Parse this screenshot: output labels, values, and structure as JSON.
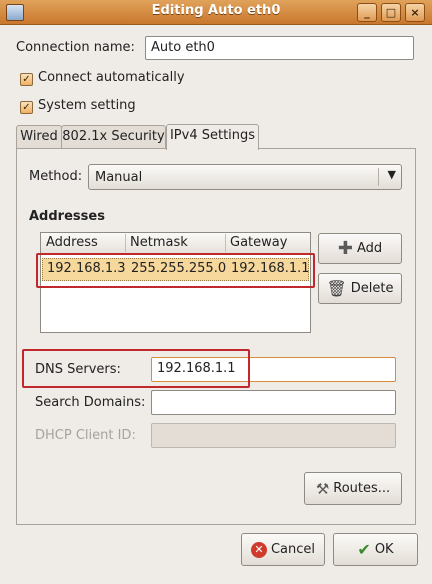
{
  "window": {
    "title": "Editing Auto eth0",
    "controls": [
      "_",
      "□",
      "×"
    ]
  },
  "connection": {
    "name_label": "Connection name:",
    "name_value": "Auto eth0"
  },
  "checkboxes": {
    "connect_auto": "Connect automatically",
    "system_setting": "System setting"
  },
  "tabs": [
    "Wired",
    "802.1x Security",
    "IPv4 Settings"
  ],
  "method": {
    "label": "Method:",
    "value": "Manual"
  },
  "addresses": {
    "title": "Addresses",
    "columns": [
      "Address",
      "Netmask",
      "Gateway"
    ],
    "rows": [
      [
        "192.168.1.3",
        "255.255.255.0",
        "192.168.1.1"
      ]
    ],
    "add_label": "Add",
    "delete_label": "Delete"
  },
  "dns": {
    "label": "DNS Servers:",
    "value": "192.168.1.1"
  },
  "search_domains": {
    "label": "Search Domains:",
    "value": ""
  },
  "dhcp_client_id": {
    "label": "DHCP Client ID:",
    "value": ""
  },
  "routes_label": "Routes...",
  "footer": {
    "cancel_label": "Cancel",
    "ok_label": "OK"
  },
  "colors": {
    "titlebar": "#c9782d",
    "highlight_row": "#f6d79c",
    "annotation": "#c0282e"
  }
}
